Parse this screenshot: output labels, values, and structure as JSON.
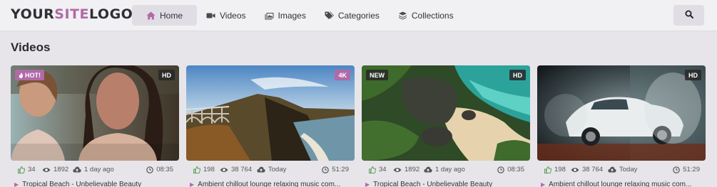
{
  "logo": {
    "part1": "YOUR",
    "part2": "SITE",
    "part3": "LOGO"
  },
  "nav": {
    "home": "Home",
    "videos": "Videos",
    "images": "Images",
    "categories": "Categories",
    "collections": "Collections"
  },
  "section_title": "Videos",
  "colors": {
    "accent": "#b06aa8",
    "like": "#5aa05a",
    "background": "#e7e5ea"
  },
  "cards": [
    {
      "badge_left": "HOT!",
      "badge_right": "HD",
      "likes": "34",
      "views": "1892",
      "date": "1 day ago",
      "duration": "08:35",
      "title": "Tropical Beach - Unbelievable Beauty"
    },
    {
      "badge_left": "",
      "badge_right": "4K",
      "likes": "198",
      "views": "38 764",
      "date": "Today",
      "duration": "51:29",
      "title": "Ambient chillout lounge relaxing music com..."
    },
    {
      "badge_left": "NEW",
      "badge_right": "HD",
      "likes": "34",
      "views": "1892",
      "date": "1 day ago",
      "duration": "08:35",
      "title": "Tropical Beach - Unbelievable Beauty"
    },
    {
      "badge_left": "",
      "badge_right": "HD",
      "likes": "198",
      "views": "38 764",
      "date": "Today",
      "duration": "51:29",
      "title": "Ambient chillout lounge relaxing music com..."
    }
  ]
}
